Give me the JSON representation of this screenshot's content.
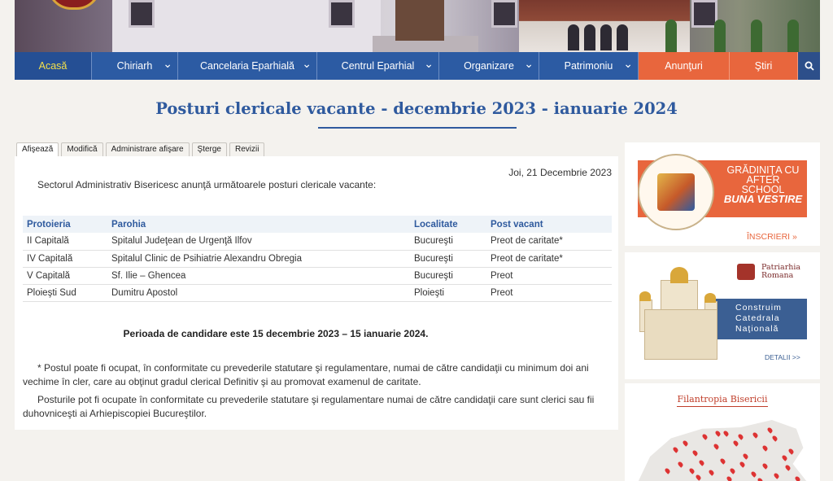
{
  "nav": {
    "items": [
      {
        "label": "Acasă",
        "active": true,
        "dropdown": false,
        "style": "blue"
      },
      {
        "label": "Chiriarh",
        "active": false,
        "dropdown": true,
        "style": "blue"
      },
      {
        "label": "Cancelaria Eparhială",
        "active": false,
        "dropdown": true,
        "style": "blue"
      },
      {
        "label": "Centrul Eparhial",
        "active": false,
        "dropdown": true,
        "style": "blue"
      },
      {
        "label": "Organizare",
        "active": false,
        "dropdown": true,
        "style": "blue"
      },
      {
        "label": "Patrimoniu",
        "active": false,
        "dropdown": true,
        "style": "blue"
      },
      {
        "label": "Anunţuri",
        "active": false,
        "dropdown": false,
        "style": "orange"
      },
      {
        "label": "Ştiri",
        "active": false,
        "dropdown": false,
        "style": "orange"
      }
    ],
    "search_icon": "search-icon"
  },
  "page": {
    "title": "Posturi clericale vacante - decembrie 2023 - ianuarie 2024"
  },
  "tabs": [
    {
      "label": "Afişează",
      "active": true
    },
    {
      "label": "Modifică",
      "active": false
    },
    {
      "label": "Administrare afişare",
      "active": false
    },
    {
      "label": "Şterge",
      "active": false
    },
    {
      "label": "Revizii",
      "active": false
    }
  ],
  "article": {
    "date": "Joi, 21 Decembrie 2023",
    "intro": "Sectorul Administrativ Bisericesc anunţă următoarele posturi clericale vacante:",
    "table": {
      "headers": [
        "Protoieria",
        "Parohia",
        "Localitate",
        "Post vacant"
      ],
      "rows": [
        [
          "II Capitală",
          "Spitalul Judeţean de Urgenţă Ilfov",
          "Bucureşti",
          "Preot de caritate*"
        ],
        [
          "IV Capitală",
          "Spitalul Clinic de Psihiatrie Alexandru Obregia",
          "Bucureşti",
          "Preot de caritate*"
        ],
        [
          "V Capitală",
          "Sf. Ilie – Ghencea",
          "Bucureşti",
          "Preot"
        ],
        [
          "Ploieşti Sud",
          "Dumitru Apostol",
          "Ploieşti",
          "Preot"
        ]
      ]
    },
    "period": "Perioada de candidare este 15 decembrie 2023 – 15 ianuarie 2024.",
    "note1": "* Postul poate fi ocupat, în conformitate cu prevederile statutare şi regulamentare, numai de către candidaţii cu minimum doi ani vechime în cler, care au obţinut gradul clerical Definitiv şi au promovat examenul de caritate.",
    "note2": "Posturile pot fi ocupate în conformitate cu prevederile statutare şi regulamentare numai de către candidaţii care sunt clerici sau fii duhovniceşti ai Arhiepiscopiei Bucureştilor."
  },
  "sidebar": {
    "kindergarten": {
      "line1": "GRĂDINIŢA CU",
      "line2": "AFTER",
      "line3": "SCHOOL",
      "line4": "BUNA VESTIRE",
      "cta": "ÎNSCRIERI »"
    },
    "cathedral": {
      "patriarchy_line1": "Patriarhia",
      "patriarchy_line2": "Romana",
      "band_line1": "Construim",
      "band_line2": "Catedrala",
      "band_line3": "Naţională",
      "more": "DETALII >>"
    },
    "philanthropy": {
      "title": "Filantropia Bisericii"
    }
  },
  "colors": {
    "nav_blue": "#2c5ba3",
    "accent_orange": "#e8663d",
    "title_blue": "#2f5a9e",
    "active_nav_text": "#f4e04a"
  }
}
